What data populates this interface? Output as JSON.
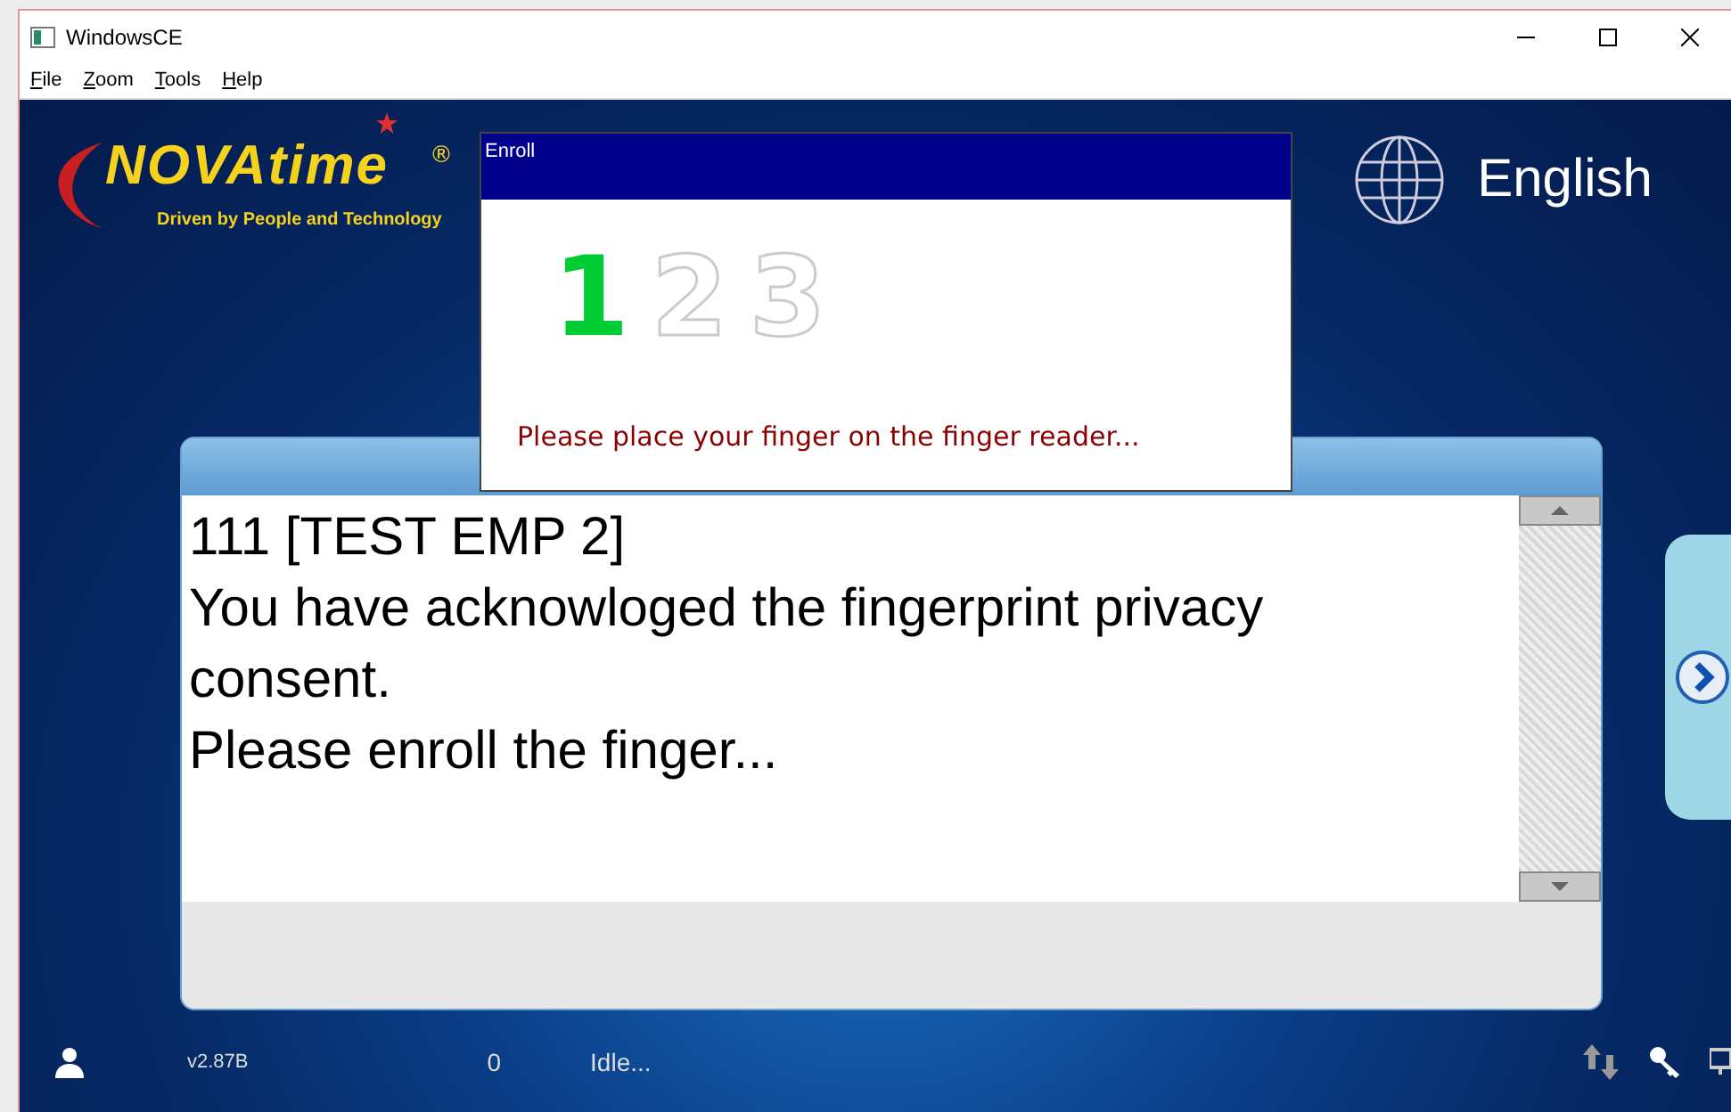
{
  "window": {
    "title": "WindowsCE"
  },
  "menu": [
    {
      "label": "File"
    },
    {
      "label": "Zoom"
    },
    {
      "label": "Tools"
    },
    {
      "label": "Help"
    }
  ],
  "logo": {
    "name": "NOVAtime",
    "mark": "®",
    "tagline": "Driven by People and Technology"
  },
  "language": "English",
  "message": {
    "lines": [
      "111 [TEST EMP 2]",
      "You have acknowloged the fingerprint privacy consent.",
      "Please enroll the finger..."
    ]
  },
  "dialog": {
    "title": "Enroll",
    "steps": [
      {
        "label": "1",
        "active": true
      },
      {
        "label": "2",
        "active": false
      },
      {
        "label": "3",
        "active": false
      }
    ],
    "prompt": "Please place your finger on the finger reader..."
  },
  "status_bar": {
    "version": "v2.87B",
    "count": "0",
    "state": "Idle..."
  }
}
